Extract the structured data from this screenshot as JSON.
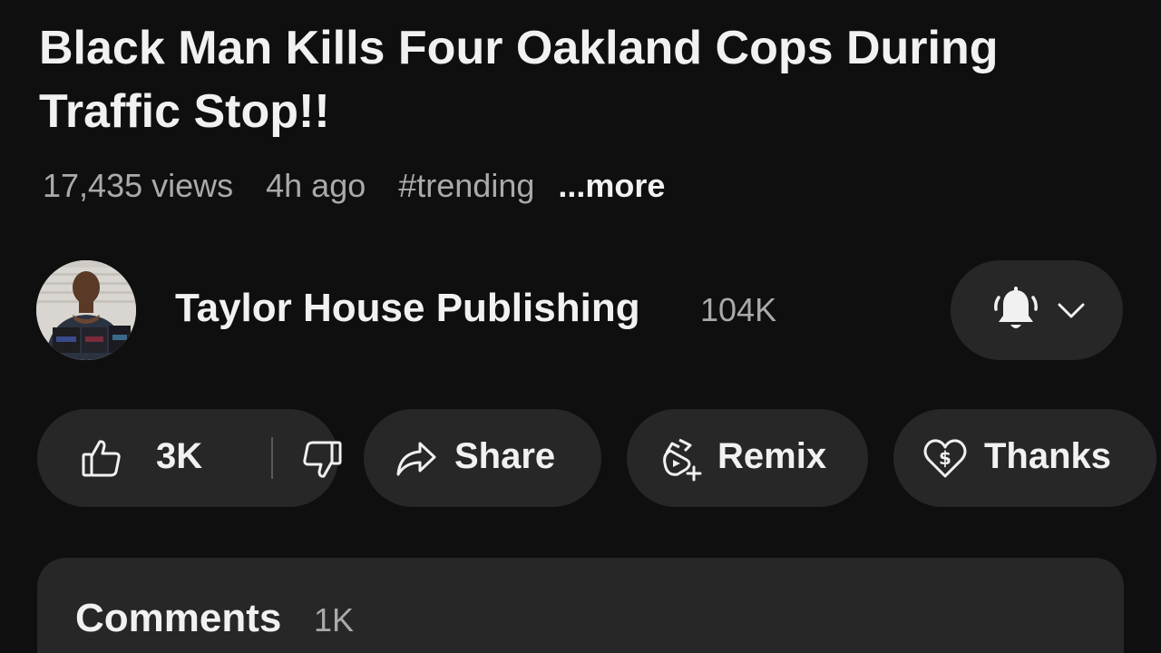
{
  "video": {
    "title": "Black Man Kills Four Oakland Cops During Traffic Stop!!",
    "views": "17,435 views",
    "age": "4h ago",
    "hashtag": "#trending",
    "more_label": "...more"
  },
  "channel": {
    "name": "Taylor House Publishing",
    "subscribers": "104K"
  },
  "actions": {
    "likes": "3K",
    "share_label": "Share",
    "remix_label": "Remix",
    "thanks_label": "Thanks"
  },
  "comments": {
    "title": "Comments",
    "count": "1K"
  },
  "icons": {
    "subscribe_bell": "bell-icon",
    "subscribe_chevron": "chevron-down-icon",
    "like": "thumbs-up-icon",
    "dislike": "thumbs-down-icon",
    "share": "share-arrow-icon",
    "remix": "remix-icon",
    "thanks": "heart-dollar-icon"
  },
  "colors": {
    "background": "#0f0f0f",
    "surface": "#272727",
    "primary_text": "#f1f1f1",
    "secondary_text": "#aaaaaa"
  }
}
